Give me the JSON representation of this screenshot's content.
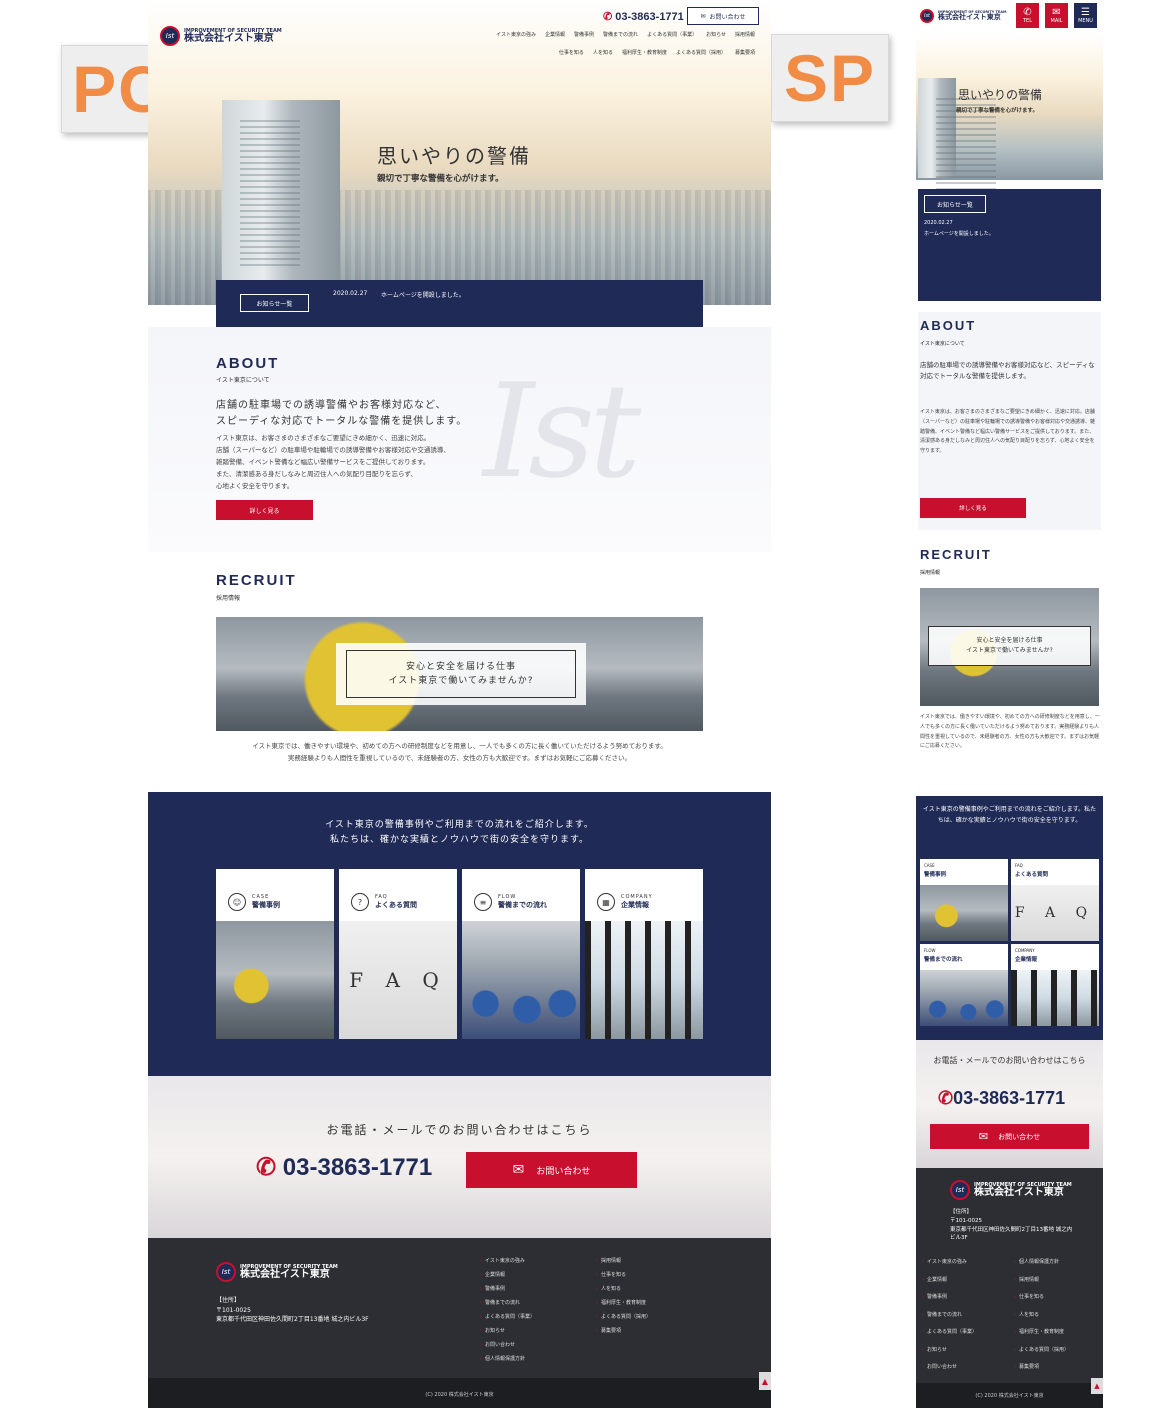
{
  "labels": {
    "pc": "PC",
    "sp": "SP"
  },
  "brand": {
    "en": "IMPROVEMENT OF SECURITY TEAM",
    "ja": "株式会社イスト東京",
    "mark": "Ist"
  },
  "header": {
    "tel": "03-3863-1771",
    "contact": "お問い合わせ",
    "nav_row1": [
      "イスト東京の強み",
      "企業情報",
      "警備事例",
      "警備までの流れ",
      "よくある質問（事業）",
      "お知らせ",
      "採用情報"
    ],
    "nav_row2": [
      "仕事を知る",
      "人を知る",
      "福利厚生・教育制度",
      "よくある質問（採用）",
      "募集要項"
    ]
  },
  "hero": {
    "title": "思いやりの警備",
    "subtitle": "親切で丁寧な警備を心がけます。"
  },
  "news": {
    "button": "お知らせ一覧",
    "date": "2020.02.27",
    "text": "ホームページを開設しました。"
  },
  "about": {
    "title": "ABOUT",
    "sub": "イスト東京について",
    "lead1": "店舗の駐車場での誘導警備やお客様対応など、",
    "lead2": "スピーディな対応でトータルな警備を提供します。",
    "body1": "イスト東京は、お客さまのさまざまなご要望にきめ細かく、迅速に対応。",
    "body2": "店舗（スーパーなど）の駐車場や駐輪場での誘導警備やお客様対応や交通誘導、",
    "body3": "雑踏警備、イベント警備など幅広い警備サービスをご提供しております。",
    "body4": "また、清潔感ある身だしなみと周辺住人への気配り目配りを忘らず、",
    "body5": "心地よく安全を守ります。",
    "watermark": "Ist",
    "button": "詳しく見る"
  },
  "recruit": {
    "title": "RECRUIT",
    "sub": "採用情報",
    "banner1": "安心と安全を届ける仕事",
    "banner2": "イスト東京で働いてみませんか?",
    "body1": "イスト東京では、働きやすい環境や、初めての方への研修制度などを用意し、一人でも多くの方に長く働いていただけるよう努めております。",
    "body2": "実務経験よりも人間性を重視しているので、未経験者の方、女性の方も大歓迎です。まずはお気軽にご応募ください。"
  },
  "services": {
    "intro1": "イスト東京の警備事例やご利用までの流れをご紹介します。",
    "intro2": "私たちは、確かな実績とノウハウで街の安全を守ります。",
    "cards": [
      {
        "en": "CASE",
        "ja": "警備事例",
        "icon": "guard-icon"
      },
      {
        "en": "FAQ",
        "ja": "よくある質問",
        "icon": "qa-icon"
      },
      {
        "en": "FLOW",
        "ja": "警備までの流れ",
        "icon": "flow-icon"
      },
      {
        "en": "COMPANY",
        "ja": "企業情報",
        "icon": "building-icon"
      }
    ],
    "faq_letters": "F A Q"
  },
  "contact": {
    "title": "お電話・メールでのお問い合わせはこちら",
    "tel": "03-3863-1771",
    "button": "お問い合わせ"
  },
  "footer": {
    "addr_label": "【住所】",
    "zip": "〒101-0025",
    "addr": "東京都千代田区神田佐久間町2丁目13番地 城之内ビル3F",
    "col1": [
      "イスト東京の強み",
      "企業情報",
      "警備事例",
      "警備までの流れ",
      "よくある質問（事業）",
      "お知らせ",
      "お問い合わせ",
      "個人情報保護方針"
    ],
    "col2": [
      "採用情報",
      "仕事を知る",
      "人を知る",
      "福利厚生・教育制度",
      "よくある質問（採用）",
      "募集要項"
    ],
    "copy": "(C) 2020 株式会社イスト東京"
  },
  "sp": {
    "tel_label": "TEL",
    "mail_label": "MAIL",
    "menu_label": "MENU",
    "about_p1": "店舗の駐車場での誘導警備やお客様対応など、スピーディな対応でトータルな警備を提供します。",
    "about_p2": "イスト東京は、お客さまのさまざまなご要望にきめ細かく、迅速に対応。店舗（スーパーなど）の駐車場や駐輪場での誘導警備やお客様対応や交通誘導、雑踏警備、イベント警備など幅広い警備サービスをご提供しております。また、清潔感ある身だしなみと周辺住人への気配り目配りを忘らず、心地よく安全を守ります。",
    "recruit_p": "イスト東京では、働きやすい環境や、初めての方への研修制度などを用意し、一人でも多くの方に長く働いていただけるよう努めております。実務経験よりも人間性を重視しているので、未経験者の方、女性の方も大歓迎です。まずはお気軽にご応募ください。",
    "services_p": "イスト東京の警備事例やご利用までの流れをご紹介します。私たちは、確かな実績とノウハウで街の安全を守ります。",
    "footer_addr": "東京都千代田区神田佐久間町2丁目13番地 城之内ビル3F",
    "footer_col1": [
      "イスト東京の強み",
      "企業情報",
      "警備事例",
      "警備までの流れ",
      "よくある質問（事業）",
      "お知らせ",
      "お問い合わせ"
    ],
    "footer_col2": [
      "個人情報保護方針",
      "採用情報",
      "仕事を知る",
      "人を知る",
      "福利厚生・教育制度",
      "よくある質問（採用）",
      "募集要項"
    ]
  }
}
